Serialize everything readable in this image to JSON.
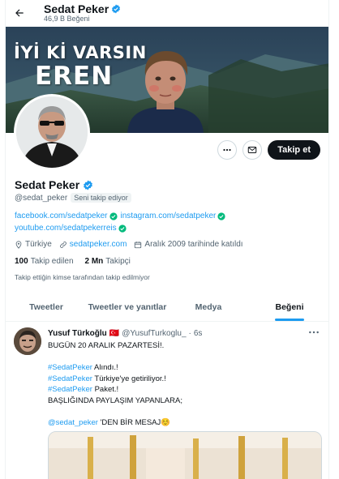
{
  "header": {
    "title": "Sedat Peker",
    "subtitle": "46,9 B Beğeni"
  },
  "banner": {
    "line1": "İYİ Kİ VARSIN",
    "line2": "EREN"
  },
  "actions": {
    "follow_label": "Takip et"
  },
  "profile": {
    "name": "Sedat Peker",
    "handle": "@sedat_peker",
    "follows_you": "Seni takip ediyor",
    "links": [
      "facebook.com/sedatpeker",
      "instagram.com/sedatpeker",
      "youtube.com/sedatpekerreis"
    ],
    "location": "Türkiye",
    "website": "sedatpeker.com",
    "joined": "Aralık 2009 tarihinde katıldı",
    "following_count": "100",
    "following_label": "Takip edilen",
    "followers_count": "2 Mn",
    "followers_label": "Takipçi",
    "not_followed_note": "Takip ettiğin kimse tarafından takip edilmiyor"
  },
  "tabs": [
    {
      "label": "Tweetler",
      "active": false
    },
    {
      "label": "Tweetler ve yanıtlar",
      "active": false
    },
    {
      "label": "Medya",
      "active": false
    },
    {
      "label": "Beğeni",
      "active": true
    }
  ],
  "tweet": {
    "author_name": "Yusuf Türkoğlu",
    "author_flag": "🇹🇷",
    "author_handle": "@YusufTurkoglu_",
    "separator": "·",
    "time": "6s",
    "line1": "BUGÜN 20 ARALIK PAZARTESİ!.",
    "line2_tag": "#SedatPeker",
    "line2_rest": " Alındı.!",
    "line3_tag": "#SedatPeker",
    "line3_rest": " Türkiye'ye getiriliyor.!",
    "line4_tag": "#SedatPeker",
    "line4_rest": " Paket.!",
    "line5": "BAŞLIĞINDA PAYLAŞIM YAPANLARA;",
    "line6_mention": "@sedat_peker",
    "line6_rest": " 'DEN BİR MESAJ☺️"
  },
  "colors": {
    "accent": "#1d9bf0",
    "verified": "#1d9bf0",
    "link_check": "#00ba7c",
    "dark": "#0f1419",
    "muted": "#536471"
  },
  "icons": {
    "back": "arrow-left-icon",
    "more": "ellipsis-icon",
    "message": "envelope-icon",
    "location": "pin-icon",
    "link": "link-icon",
    "calendar": "calendar-icon"
  }
}
